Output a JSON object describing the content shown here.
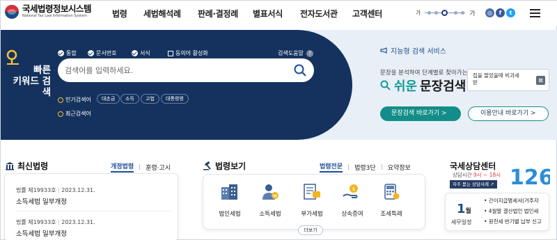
{
  "header": {
    "logo_title": "국세법령정보시스템",
    "logo_subtitle": "National Tax Law Information System",
    "nav": [
      "법령",
      "세법해석례",
      "판례·결정례",
      "별표서식",
      "전자도서관",
      "고객센터"
    ],
    "font_small": "가",
    "font_large": "가"
  },
  "search": {
    "quick_title_1": "빠른",
    "quick_title_2": "키워드 검색",
    "options": [
      {
        "label": "통합",
        "checked": true
      },
      {
        "label": "문서번호",
        "checked": true
      },
      {
        "label": "서식",
        "checked": true
      },
      {
        "label": "동의어 활성화",
        "checked": false
      }
    ],
    "help_label": "검색도움말",
    "help_icon": "?",
    "placeholder": "검색어를 입력하세요.",
    "popular_label": "인기검색어",
    "popular_tags": [
      "대손금",
      "소득",
      "고법",
      "대통령령"
    ],
    "recent_label": "최근검색어"
  },
  "intelligent": {
    "title": "지능형 검색 서비스",
    "desc": "문장을 분석하여 단계별로 찾아가는",
    "easy": "쉬운",
    "sentence": "문장검색",
    "box_text_1": "집을 팔았을때 비과세",
    "box_text_2": "받",
    "box_btn": "⊠",
    "btn_primary": "문장검색 바로가기 >",
    "btn_secondary": "이용안내 바로가기 >"
  },
  "latest": {
    "title": "최신법령",
    "tabs": [
      "개정법령",
      "훈령·고시"
    ],
    "items": [
      {
        "meta_a": "법률 제19933호",
        "meta_b": "2023.12.31.",
        "title": "소득세법 일부개정"
      },
      {
        "meta_a": "법률 제19933호",
        "meta_b": "2023.12.31.",
        "title": "소득세법 일부개정"
      }
    ]
  },
  "lawview": {
    "title": "법령보기",
    "tabs": [
      "법령전문",
      "법령3단",
      "요약정보"
    ],
    "categories": [
      "법인세법",
      "소득세법",
      "부가세법",
      "상속증여",
      "조세특례"
    ],
    "more": "더보기"
  },
  "center": {
    "title": "국세상담센터",
    "hours_prefix": "상담시간",
    "hours": "9시 ~ 18시",
    "badge": "자주 묻는 상담사례 ↗",
    "number": "126",
    "month": "1",
    "month_unit": "월",
    "schedule_label": "세무일정",
    "schedule": [
      "• 간이지급명세서(거주자",
      "• 4월말 결산법인 법인세",
      "• 원천세 반기별 납부 신고"
    ]
  },
  "colors": {
    "navy": "#15325e",
    "teal": "#138d88",
    "light": "#e8eff7",
    "accent": "#1d4e96"
  }
}
